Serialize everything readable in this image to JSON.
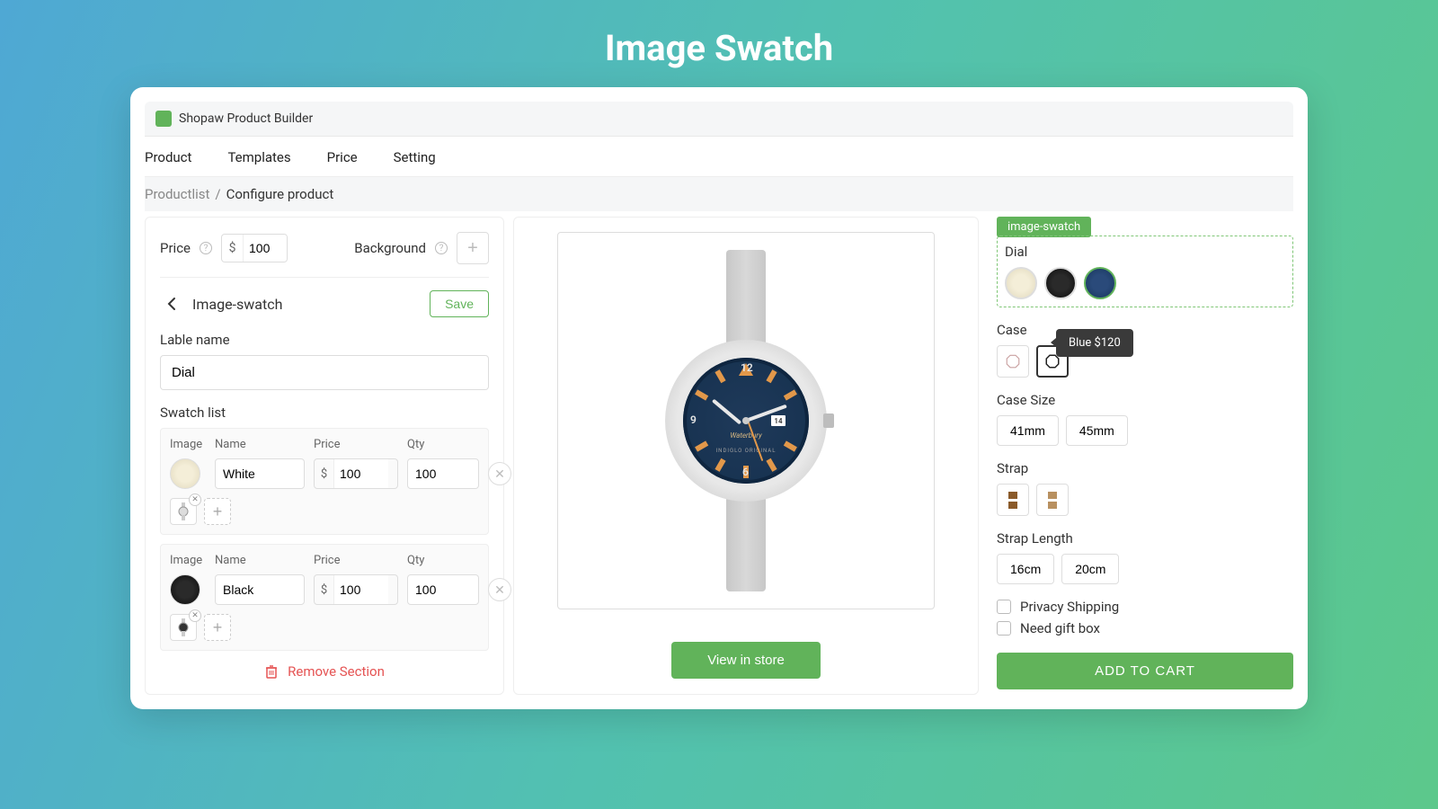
{
  "hero_title": "Image Swatch",
  "app_title": "Shopaw Product Builder",
  "tabs": [
    "Product",
    "Templates",
    "Price",
    "Setting"
  ],
  "breadcrumb": {
    "parent": "Productlist",
    "sep": "/",
    "current": "Configure product"
  },
  "left": {
    "price_label": "Price",
    "currency": "$",
    "price_value": "100",
    "background_label": "Background",
    "section_title": "Image-swatch",
    "save_label": "Save",
    "label_name_label": "Lable name",
    "label_name_value": "Dial",
    "swatch_list_label": "Swatch list",
    "col_image": "Image",
    "col_name": "Name",
    "col_price": "Price",
    "col_qty": "Qty",
    "rows": [
      {
        "name": "White",
        "price": "100",
        "qty": "100"
      },
      {
        "name": "Black",
        "price": "100",
        "qty": "100"
      }
    ],
    "remove_label": "Remove Section"
  },
  "center": {
    "dial_date": "14",
    "brand": "Waterbury",
    "sub_brand": "INDIGLO ORIGINAL",
    "view_store_label": "View in store"
  },
  "right": {
    "badge": "image-swatch",
    "dial_label": "Dial",
    "dial_tooltip": "Blue $120",
    "case_label": "Case",
    "case_size_label": "Case Size",
    "case_sizes": [
      "41mm",
      "45mm"
    ],
    "strap_label": "Strap",
    "strap_length_label": "Strap Length",
    "strap_lengths": [
      "16cm",
      "20cm"
    ],
    "privacy_label": "Privacy Shipping",
    "gift_label": "Need gift box",
    "add_cart_label": "ADD TO CART"
  }
}
